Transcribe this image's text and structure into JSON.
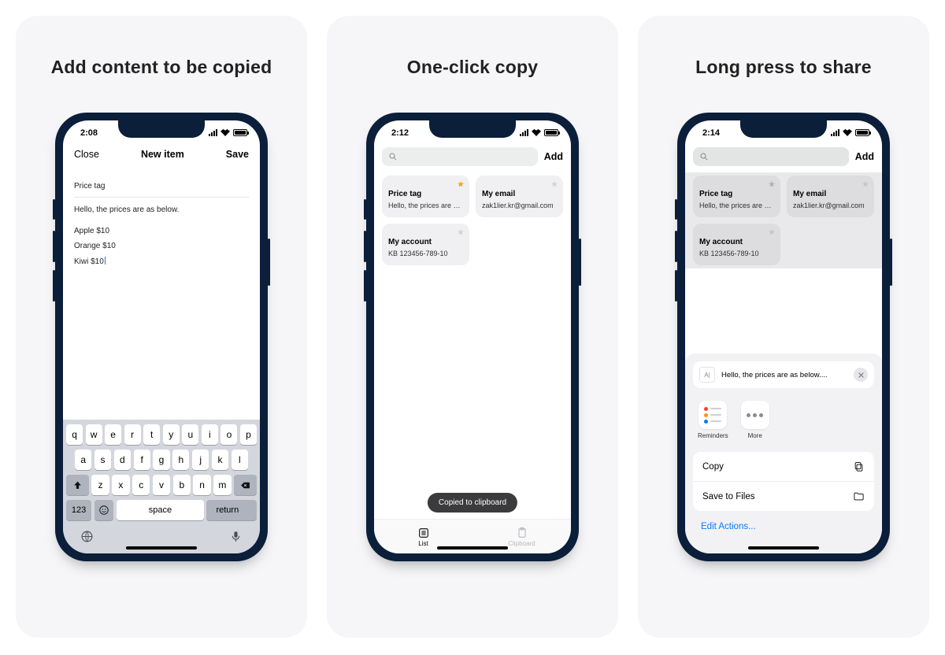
{
  "panels": [
    {
      "title": "Add content to be copied"
    },
    {
      "title": "One-click copy"
    },
    {
      "title": "Long press to share"
    }
  ],
  "status": {
    "time1": "2:08",
    "time2": "2:12",
    "time3": "2:14"
  },
  "s1": {
    "nav": {
      "close": "Close",
      "title": "New item",
      "save": "Save"
    },
    "label": "Price tag",
    "intro": "Hello, the prices are as below.",
    "lines": [
      "Apple $10",
      "Orange $10",
      "Kiwi $10"
    ],
    "keyboard": {
      "row1": [
        "q",
        "w",
        "e",
        "r",
        "t",
        "y",
        "u",
        "i",
        "o",
        "p"
      ],
      "row2": [
        "a",
        "s",
        "d",
        "f",
        "g",
        "h",
        "j",
        "k",
        "l"
      ],
      "row3": [
        "z",
        "x",
        "c",
        "v",
        "b",
        "n",
        "m"
      ],
      "num": "123",
      "space": "space",
      "return": "return"
    }
  },
  "s2": {
    "add": "Add",
    "cards": [
      {
        "title": "Price tag",
        "sub": "Hello, the prices are as...",
        "star": true
      },
      {
        "title": "My email",
        "sub": "zak1lier.kr@gmail.com",
        "star": false
      },
      {
        "title": "My account",
        "sub": "KB 123456-789-10",
        "star": false
      }
    ],
    "toast": "Copied to clipboard",
    "tabs": {
      "list": "List",
      "clipboard": "Clipboard"
    }
  },
  "s3": {
    "add": "Add",
    "cards": [
      {
        "title": "Price tag",
        "sub": "Hello, the prices are as...",
        "star": true
      },
      {
        "title": "My email",
        "sub": "zak1lier.kr@gmail.com",
        "star": false
      },
      {
        "title": "My account",
        "sub": "KB 123456-789-10",
        "star": false
      }
    ],
    "sheet": {
      "preview": "Hello, the prices are as below....",
      "apps": {
        "reminders": "Reminders",
        "more": "More"
      },
      "actions": {
        "copy": "Copy",
        "save": "Save to Files"
      },
      "edit": "Edit Actions..."
    }
  }
}
